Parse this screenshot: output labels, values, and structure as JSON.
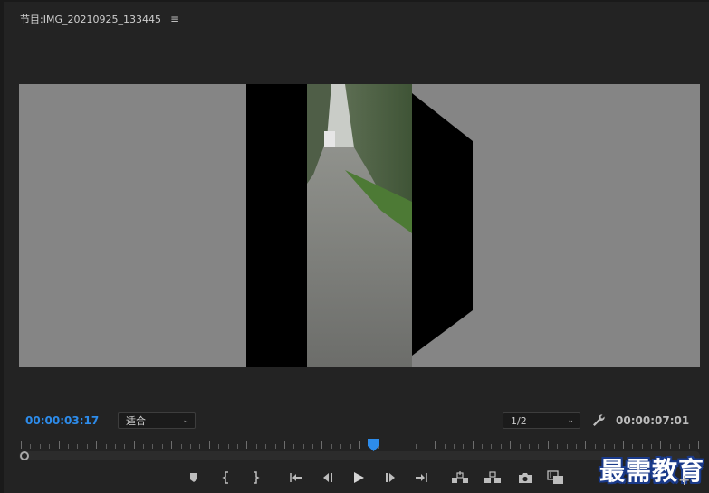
{
  "panel": {
    "title_prefix": "节目: ",
    "clip_name": "IMG_20210925_133445",
    "menu_icon": "hamburger-menu-icon"
  },
  "playback": {
    "current_time": "00:00:03:17",
    "duration": "00:00:07:01",
    "zoom_value": "适合",
    "resolution_value": "1/2",
    "playhead_fraction": 0.52
  },
  "transport": {
    "buttons": [
      {
        "name": "add-marker-icon"
      },
      {
        "name": "mark-in-icon"
      },
      {
        "name": "mark-out-icon"
      },
      {
        "name": "go-to-in-icon"
      },
      {
        "name": "step-back-icon"
      },
      {
        "name": "play-icon"
      },
      {
        "name": "step-forward-icon"
      },
      {
        "name": "go-to-out-icon"
      },
      {
        "name": "lift-icon"
      },
      {
        "name": "extract-icon"
      },
      {
        "name": "export-frame-icon"
      },
      {
        "name": "comparison-view-icon"
      }
    ]
  },
  "watermark": {
    "text": "最需教育"
  },
  "colors": {
    "accent": "#2d8ceb",
    "viewer_bg": "#858585",
    "panel_bg": "#232323"
  }
}
